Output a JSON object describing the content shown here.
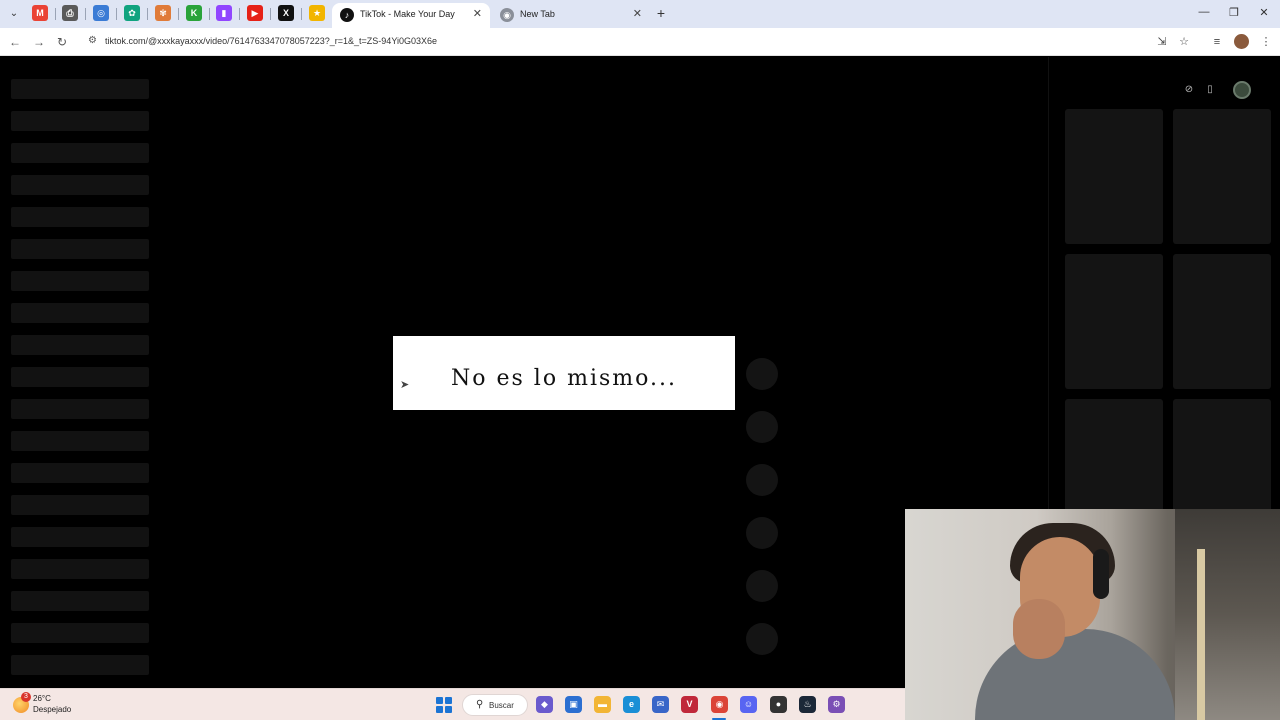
{
  "browser": {
    "pinned_tabs": [
      {
        "icon": "gmail-icon",
        "glyph": "M",
        "color": "#ea4335"
      },
      {
        "icon": "printer-icon",
        "glyph": "⎙",
        "color": "#5a5a5a"
      },
      {
        "icon": "edge-swirl-icon",
        "glyph": "◎",
        "color": "#3a7bd5"
      },
      {
        "icon": "chatgpt-icon",
        "glyph": "✿",
        "color": "#10a37f"
      },
      {
        "icon": "butterfly-icon",
        "glyph": "✾",
        "color": "#e07b39"
      },
      {
        "icon": "kick-icon",
        "glyph": "K",
        "color": "#2aa33a"
      },
      {
        "icon": "twitch-icon",
        "glyph": "▮",
        "color": "#9146ff"
      },
      {
        "icon": "youtube-icon",
        "glyph": "▶",
        "color": "#e62117"
      },
      {
        "icon": "x-icon",
        "glyph": "X",
        "color": "#111111"
      },
      {
        "icon": "star-app-icon",
        "glyph": "★",
        "color": "#f2b500"
      }
    ],
    "active_tab": {
      "title": "TikTok - Make Your Day",
      "icon": "tiktok-icon"
    },
    "inactive_tab": {
      "title": "New Tab",
      "icon": "chrome-icon"
    },
    "close_glyph": "✕",
    "new_tab_glyph": "+",
    "url": "tiktok.com/@xxxkayaxxx/video/7614763347078057223?_r=1&_t=ZS-94Yi0G03X6e",
    "window_controls": [
      "—",
      "❐",
      "✕"
    ]
  },
  "video": {
    "caption": "No es lo mismo..."
  },
  "taskbar": {
    "weather_temp": "26°C",
    "weather_desc": "Despejado",
    "weather_badge": "3",
    "search_label": "Buscar",
    "apps": [
      {
        "name": "copilot-app",
        "glyph": "◆",
        "color": "#6a5acd"
      },
      {
        "name": "store-app",
        "glyph": "▣",
        "color": "#2c6fd1"
      },
      {
        "name": "file-explorer-app",
        "glyph": "▬",
        "color": "#f2b535"
      },
      {
        "name": "edge-app",
        "glyph": "e",
        "color": "#1a8fd6"
      },
      {
        "name": "outlook-app",
        "glyph": "✉",
        "color": "#3866c8"
      },
      {
        "name": "valorant-app",
        "glyph": "V",
        "color": "#c0283a"
      },
      {
        "name": "chrome-app",
        "glyph": "◉",
        "color": "#db4437"
      },
      {
        "name": "discord-app",
        "glyph": "☺",
        "color": "#5865f2"
      },
      {
        "name": "obs-app",
        "glyph": "●",
        "color": "#333333"
      },
      {
        "name": "steam-app",
        "glyph": "♨",
        "color": "#1b2838"
      },
      {
        "name": "settings-app",
        "glyph": "⚙",
        "color": "#7a4fb5"
      }
    ]
  }
}
